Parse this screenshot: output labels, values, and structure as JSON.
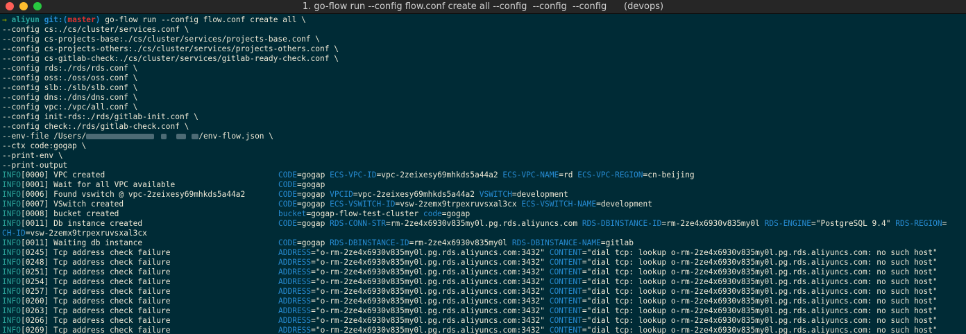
{
  "window": {
    "title": "1. go-flow run --config flow.conf create all --config  --config  --config      (devops)",
    "colors": {
      "close": "#ff5f57",
      "minimize": "#febc2e",
      "zoom": "#28c840",
      "background": "#002b36"
    }
  },
  "prompt": {
    "arrow": "→",
    "dir": "aliyun",
    "git_label": "git:(",
    "branch": "master",
    "git_close": ")",
    "command": "go-flow run --config flow.conf create all \\"
  },
  "command_lines": [
    "--config cs:./cs/cluster/services.conf \\",
    "--config cs-projects-base:./cs/cluster/services/projects-base.conf \\",
    "--config cs-projects-others:./cs/cluster/services/projects-others.conf \\",
    "--config cs-gitlab-check:./cs/cluster/services/gitlab-ready-check.conf \\",
    "--config rds:./rds/rds.conf \\",
    "--config oss:./oss/oss.conf \\",
    "--config slb:./slb/slb.conf \\",
    "--config dns:./dns/dns.conf \\",
    "--config vpc:./vpc/all.conf \\",
    "--config init-rds:./rds/gitlab-init.conf \\",
    "--config check:./rds/gitlab-check.conf \\"
  ],
  "envfile": {
    "prefix": "--env-file /Users/",
    "suffix": "/env-flow.json \\"
  },
  "tail_lines": [
    "--ctx code:gogap \\",
    "--print-env \\",
    "--print-output"
  ],
  "logs": [
    {
      "level": "INFO",
      "code": "[0000]",
      "msg": "VPC created",
      "fields": [
        {
          "k": "CODE",
          "v": "gogap"
        },
        {
          "k": "ECS-VPC-ID",
          "v": "vpc-2zeixesy69mhkds5a44a2"
        },
        {
          "k": "ECS-VPC-NAME",
          "v": "rd"
        },
        {
          "k": "ECS-VPC-REGION",
          "v": "cn-beijing"
        }
      ]
    },
    {
      "level": "INFO",
      "code": "[0001]",
      "msg": "Wait for all VPC available",
      "fields": [
        {
          "k": "CODE",
          "v": "gogap"
        }
      ]
    },
    {
      "level": "INFO",
      "code": "[0006]",
      "msg": "Found vswitch @ vpc-2zeixesy69mhkds5a44a2",
      "fields": [
        {
          "k": "CODE",
          "v": "gogap"
        },
        {
          "k": "VPCID",
          "v": "vpc-2zeixesy69mhkds5a44a2"
        },
        {
          "k": "VSWITCH",
          "v": "development"
        }
      ]
    },
    {
      "level": "INFO",
      "code": "[0007]",
      "msg": "VSwitch created",
      "fields": [
        {
          "k": "CODE",
          "v": "gogap"
        },
        {
          "k": "ECS-VSWITCH-ID",
          "v": "vsw-2zemx9trpexruvsxal3cx"
        },
        {
          "k": "ECS-VSWITCH-NAME",
          "v": "development"
        }
      ]
    },
    {
      "level": "INFO",
      "code": "[0008]",
      "msg": "bucket created",
      "fields": [
        {
          "k": "bucket",
          "v": "gogap-flow-test-cluster"
        },
        {
          "k": "code",
          "v": "gogap"
        }
      ]
    },
    {
      "level": "INFO",
      "code": "[0011]",
      "msg": "Db instance created",
      "fields": [
        {
          "k": "CODE",
          "v": "gogap"
        },
        {
          "k": "RDS-CONN-STR",
          "v": "rm-2ze4x6930v835my0l.pg.rds.aliyuncs.com"
        },
        {
          "k": "RDS-DBINSTANCE-ID",
          "v": "rm-2ze4x6930v835my0l"
        },
        {
          "k": "RDS-ENGINE",
          "v": "\"PostgreSQL 9.4\""
        },
        {
          "k": "RDS-REGION",
          "v": ""
        }
      ]
    }
  ],
  "wrap_line": {
    "k": "CH-ID",
    "v": "vsw-2zemx9trpexruvsxal3cx"
  },
  "logs2": [
    {
      "level": "INFO",
      "code": "[0011]",
      "msg": "Waiting db instance",
      "fields": [
        {
          "k": "CODE",
          "v": "gogap"
        },
        {
          "k": "RDS-DBINSTANCE-ID",
          "v": "rm-2ze4x6930v835my0l"
        },
        {
          "k": "RDS-DBINSTANCE-NAME",
          "v": "gitlab"
        }
      ]
    }
  ],
  "failures": {
    "msg": "Tcp address check failure",
    "address": "\"o-rm-2ze4x6930v835my0l.pg.rds.aliyuncs.com:3432\"",
    "content": "\"dial tcp: lookup o-rm-2ze4x6930v835my0l.pg.rds.aliyuncs.com: no such host\"",
    "codes": [
      "[0245]",
      "[0248]",
      "[0251]",
      "[0254]",
      "[0257]",
      "[0260]",
      "[0263]",
      "[0266]",
      "[0269]"
    ]
  }
}
